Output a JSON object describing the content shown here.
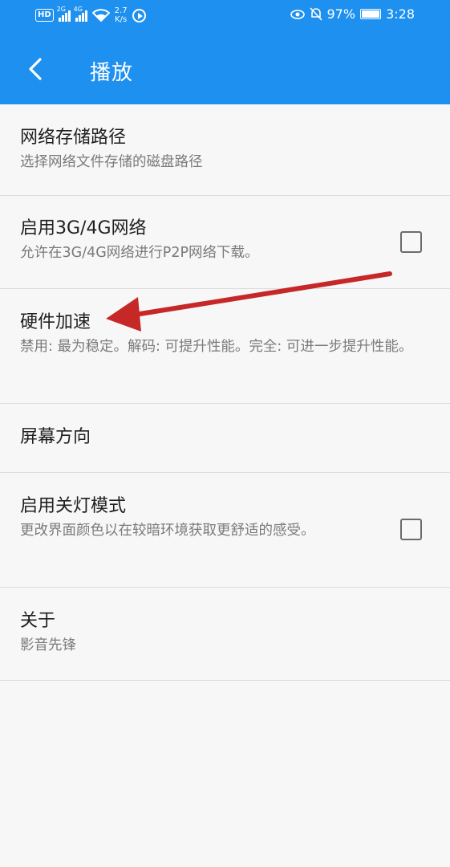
{
  "status_bar": {
    "hd_badge": "HD",
    "signal_1_label": "2G",
    "signal_2_label": "4G",
    "net_speed": "2.7",
    "net_speed_unit": "K/s",
    "battery_percent": "97%",
    "time": "3:28"
  },
  "header": {
    "title": "播放",
    "background_color": "#1e90f0"
  },
  "settings": {
    "items": [
      {
        "title": "网络存储路径",
        "subtitle": "选择网络文件存储的磁盘路径"
      },
      {
        "title": "启用3G/4G网络",
        "subtitle": "允许在3G/4G网络进行P2P网络下载。",
        "checked": false
      },
      {
        "title": "硬件加速",
        "subtitle": "禁用: 最为稳定。解码: 可提升性能。完全: 可进一步提升性能。"
      },
      {
        "title": "屏幕方向"
      },
      {
        "title": "启用关灯模式",
        "subtitle": "更改界面颜色以在较暗环境获取更舒适的感受。",
        "checked": false
      },
      {
        "title": "关于",
        "subtitle": "影音先锋"
      }
    ]
  },
  "annotation": {
    "arrow_color": "#c62828",
    "points_to": "硬件加速"
  }
}
